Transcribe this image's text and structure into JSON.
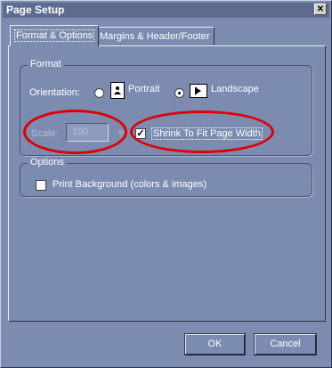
{
  "window": {
    "title": "Page Setup",
    "close_glyph": "✕"
  },
  "tabs": [
    {
      "label": "Format & Options",
      "active": true
    },
    {
      "label": "Margins & Header/Footer",
      "active": false
    }
  ],
  "format": {
    "group_label": "Format",
    "orientation_label": "Orientation:",
    "portrait_label": "Portrait",
    "landscape_label": "Landscape",
    "selected": "Landscape",
    "scale_label": "Scale:",
    "scale_value": "100",
    "percent_label": "%",
    "shrink_label": "Shrink To Fit Page Width",
    "shrink_checked": true
  },
  "options": {
    "group_label": "Options",
    "print_background_label": "Print Background (colors & images)",
    "print_background_checked": false
  },
  "buttons": {
    "ok": "OK",
    "cancel": "Cancel"
  },
  "annotation_color": "#e00000"
}
